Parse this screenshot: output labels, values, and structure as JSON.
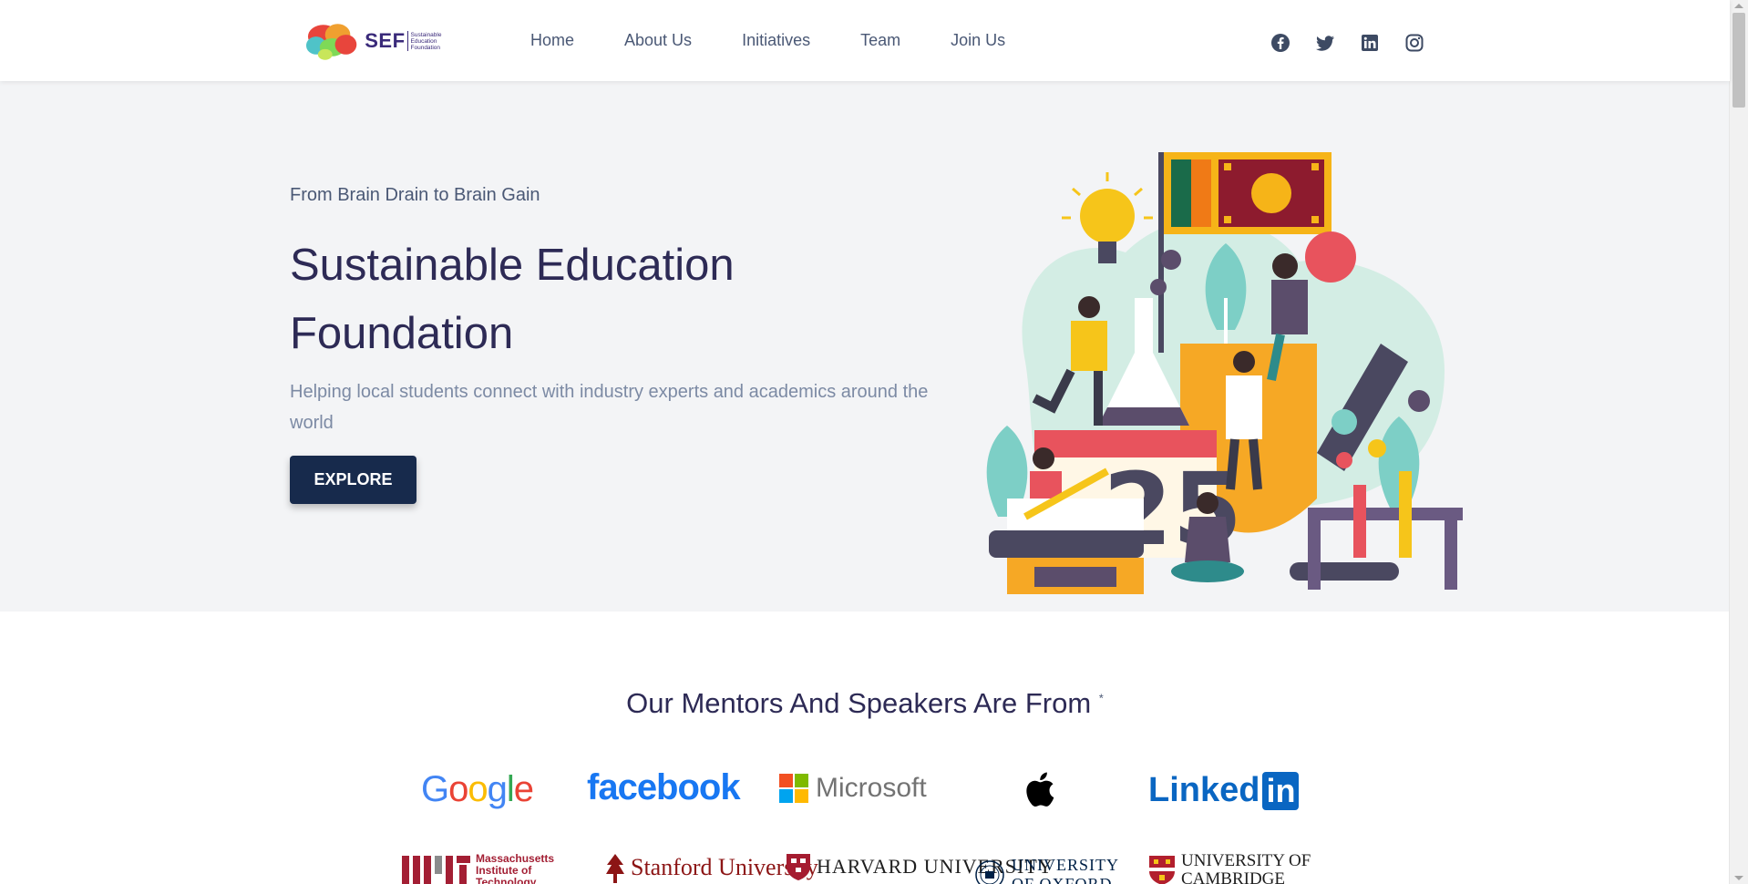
{
  "header": {
    "logo": {
      "text": "SEF",
      "subtitle": "Sustainable Education Foundation"
    },
    "nav": [
      "Home",
      "About Us",
      "Initiatives",
      "Team",
      "Join Us"
    ],
    "social_icons": [
      "facebook-icon",
      "twitter-icon",
      "linkedin-icon",
      "instagram-icon"
    ]
  },
  "hero": {
    "tagline": "From Brain Drain to Brain Gain",
    "title": "Sustainable Education Foundation",
    "description": "Helping local students connect with industry experts and academics around the world",
    "cta_label": "EXPLORE"
  },
  "partners": {
    "title": "Our Mentors And Speakers Are From",
    "asterisk": "*",
    "companies": [
      "Google",
      "facebook",
      "Microsoft",
      "Apple",
      "LinkedIn"
    ],
    "universities": [
      {
        "name": "Massachusetts Institute of Technology"
      },
      {
        "name": "Stanford University"
      },
      {
        "name": "HARVARD UNIVERSITY"
      },
      {
        "name": "UNIVERSITY OF OXFORD"
      },
      {
        "name": "UNIVERSITY OF CAMBRIDGE"
      }
    ]
  },
  "colors": {
    "navy": "#172a4c",
    "title": "#2d2a55",
    "nav_text": "#4a5875",
    "hero_bg": "#f3f4f6",
    "muted": "#7c8aa4"
  }
}
